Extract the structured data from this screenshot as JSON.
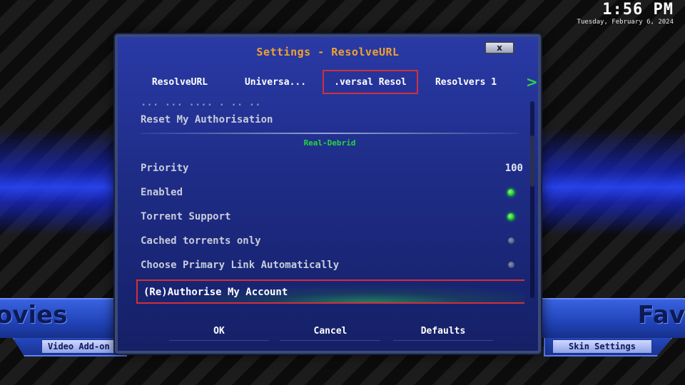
{
  "clock": {
    "time": "1:56 PM",
    "date": "Tuesday, February 6, 2024"
  },
  "background": {
    "left_word": "ovies",
    "right_word": "Fav",
    "left_tile": "Video Add-on",
    "right_tile": "Skin Settings"
  },
  "dialog": {
    "title": "Settings - ResolveURL",
    "close_label": "x",
    "tabs": [
      {
        "label": "ResolveURL"
      },
      {
        "label": "Universa..."
      },
      {
        "label": ".versal Resol"
      },
      {
        "label": "Resolvers 1"
      }
    ],
    "next_arrow": ">",
    "partial_row": "... ... .... . .. ..",
    "reset_label": "Reset My Authorisation",
    "section_header": "Real-Debrid",
    "rows": [
      {
        "label": "Priority",
        "value": "100"
      },
      {
        "label": "Enabled",
        "state": "on"
      },
      {
        "label": "Torrent Support",
        "state": "on"
      },
      {
        "label": "Cached torrents only",
        "state": "off"
      },
      {
        "label": "Choose Primary Link Automatically",
        "state": "off"
      },
      {
        "label": "(Re)Authorise My Account"
      }
    ],
    "buttons": {
      "ok": "OK",
      "cancel": "Cancel",
      "defaults": "Defaults"
    }
  },
  "colors": {
    "accent_title": "#f0a030",
    "section_header": "#27d63e",
    "focus_border": "#d0303a",
    "toggle_on": "#18c020"
  }
}
